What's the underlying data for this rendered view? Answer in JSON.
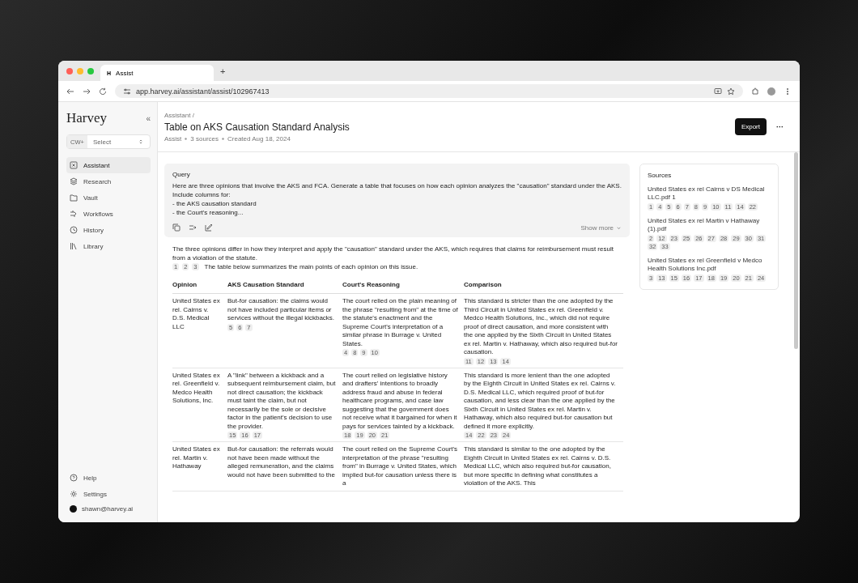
{
  "browser": {
    "tab": {
      "icon": "H",
      "title": "Assist"
    },
    "new_tab": "+",
    "url": "app.harvey.ai/assistant/assist/102967413"
  },
  "sidebar": {
    "logo": "Harvey",
    "collapse": "«",
    "workspace": {
      "badge": "CW+",
      "select": "Select"
    },
    "nav": [
      {
        "label": "Assistant",
        "selected": true
      },
      {
        "label": "Research",
        "selected": false
      },
      {
        "label": "Vault",
        "selected": false
      },
      {
        "label": "Workflows",
        "selected": false
      },
      {
        "label": "History",
        "selected": false
      },
      {
        "label": "Library",
        "selected": false
      }
    ],
    "footer": [
      {
        "label": "Help"
      },
      {
        "label": "Settings"
      }
    ],
    "user": "shawn@harvey.ai"
  },
  "header": {
    "breadcrumb": "Assistant /",
    "title": "Table on AKS Causation Standard Analysis",
    "meta": [
      "Assist",
      "3 sources",
      "Created Aug 18, 2024"
    ],
    "export": "Export",
    "more": "···"
  },
  "query": {
    "label": "Query",
    "lines": [
      "Here are three opinions that involve the AKS and FCA. Generate a table that focuses on how each opinion analyzes the \"causation\" standard under the AKS. Include columns for:",
      "- the AKS causation standard",
      "- the Court's reasoning..."
    ],
    "show_more": "Show more"
  },
  "answer": {
    "text": "The three opinions differ in how they interpret and apply the \"causation\" standard under the AKS, which requires that claims for reimbursement must result from a violation of the statute.",
    "citations": [
      "1",
      "2",
      "3"
    ],
    "text_after": "The table below summarizes the main points of each opinion on this issue."
  },
  "table": {
    "columns": [
      "Opinion",
      "AKS Causation Standard",
      "Court's Reasoning",
      "Comparison"
    ],
    "rows": [
      [
        {
          "text": "United States ex rel. Cairns v. D.S. Medical LLC"
        },
        {
          "text": "But-for causation: the claims would not have included particular items or services without the illegal kickbacks.",
          "citations": [
            "5",
            "6",
            "7"
          ]
        },
        {
          "text": "The court relied on the plain meaning of the phrase \"resulting from\" at the time of the statute's enactment and the Supreme Court's interpretation of a similar phrase in Burrage v. United States.",
          "citations": [
            "4",
            "8",
            "9",
            "10"
          ]
        },
        {
          "text": "This standard is stricter than the one adopted by the Third Circuit in United States ex rel. Greenfield v. Medco Health Solutions, Inc., which did not require proof of direct causation, and more consistent with the one applied by the Sixth Circuit in United States ex rel. Martin v. Hathaway, which also required but-for causation.",
          "citations": [
            "11",
            "12",
            "13",
            "14"
          ]
        }
      ],
      [
        {
          "text": "United States ex rel. Greenfield v. Medco Health Solutions, Inc."
        },
        {
          "text": "A \"link\" between a kickback and a subsequent reimbursement claim, but not direct causation; the kickback must taint the claim, but not necessarily be the sole or decisive factor in the patient's decision to use the provider.",
          "citations": [
            "15",
            "16",
            "17"
          ]
        },
        {
          "text": "The court relied on legislative history and drafters' intentions to broadly address fraud and abuse in federal healthcare programs, and case law suggesting that the government does not receive what it bargained for when it pays for services tainted by a kickback.",
          "citations": [
            "18",
            "19",
            "20",
            "21"
          ]
        },
        {
          "text": "This standard is more lenient than the one adopted by the Eighth Circuit in United States ex rel. Cairns v. D.S. Medical LLC, which required proof of but-for causation, and less clear than the one applied by the Sixth Circuit in United States ex rel. Martin v. Hathaway, which also required but-for causation but defined it more explicitly.",
          "citations": [
            "14",
            "22",
            "23",
            "24"
          ]
        }
      ],
      [
        {
          "text": "United States ex rel. Martin v. Hathaway"
        },
        {
          "text": "But-for causation: the referrals would not have been made without the alleged remuneration, and the claims would not have been submitted to the"
        },
        {
          "text": "The court relied on the Supreme Court's interpretation of the phrase \"resulting from\" in Burrage v. United States, which implied but-for causation unless there is a"
        },
        {
          "text": "This standard is similar to the one adopted by the Eighth Circuit in United States ex rel. Cairns v. D.S. Medical LLC, which also required but-for causation, but more specific in defining what constitutes a violation of the AKS. This"
        }
      ]
    ]
  },
  "sources": {
    "title": "Sources",
    "items": [
      {
        "name": "United States ex rel Cairns v DS Medical LLC.pdf 1",
        "citations": [
          "1",
          "4",
          "5",
          "6",
          "7",
          "8",
          "9",
          "10",
          "11",
          "14",
          "22"
        ]
      },
      {
        "name": "United States ex rel Martin v Hathaway (1).pdf",
        "citations": [
          "2",
          "12",
          "23",
          "25",
          "26",
          "27",
          "28",
          "29",
          "30",
          "31",
          "32",
          "33"
        ]
      },
      {
        "name": "United States ex rel Greenfield v Medco Health Solutions Inc.pdf",
        "citations": [
          "3",
          "13",
          "15",
          "16",
          "17",
          "18",
          "19",
          "20",
          "21",
          "24"
        ]
      }
    ]
  }
}
